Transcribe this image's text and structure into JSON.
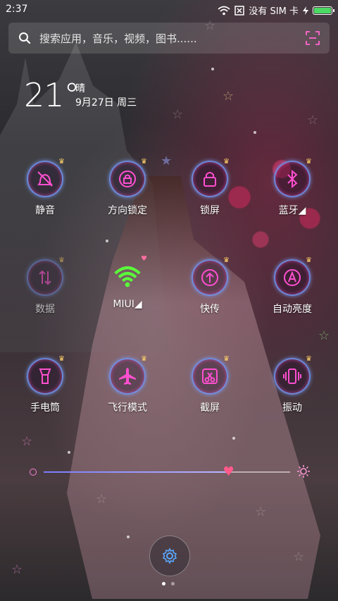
{
  "status": {
    "time": "2:37",
    "sim": "没有 SIM 卡",
    "battery_level": 1.0
  },
  "search": {
    "placeholder": "搜索应用，音乐，视频，图书......"
  },
  "weather": {
    "temperature": "21°",
    "condition": "晴",
    "date": "9月27日 周三"
  },
  "toggles": [
    {
      "label": "静音",
      "icon": "mute-bell-icon",
      "active": true
    },
    {
      "label": "方向锁定",
      "icon": "rotation-lock-icon",
      "active": true
    },
    {
      "label": "锁屏",
      "icon": "lock-icon",
      "active": true
    },
    {
      "label": "蓝牙◢",
      "icon": "bluetooth-icon",
      "active": true
    },
    {
      "label": "数据",
      "icon": "data-icon",
      "active": false
    },
    {
      "label": "MIUI◢",
      "icon": "wifi-icon",
      "active": true
    },
    {
      "label": "快传",
      "icon": "transfer-icon",
      "active": true
    },
    {
      "label": "自动亮度",
      "icon": "auto-brightness-icon",
      "active": true
    },
    {
      "label": "手电筒",
      "icon": "flashlight-icon",
      "active": true
    },
    {
      "label": "飞行模式",
      "icon": "airplane-icon",
      "active": true
    },
    {
      "label": "截屏",
      "icon": "screenshot-icon",
      "active": true
    },
    {
      "label": "振动",
      "icon": "vibrate-icon",
      "active": true
    }
  ],
  "brightness": {
    "level": 0.75
  },
  "colors": {
    "neon_pink": "#ff4fd0",
    "neon_blue": "#7fa8ff",
    "wifi_green": "#5aff3a",
    "battery_green": "#4cd964"
  }
}
